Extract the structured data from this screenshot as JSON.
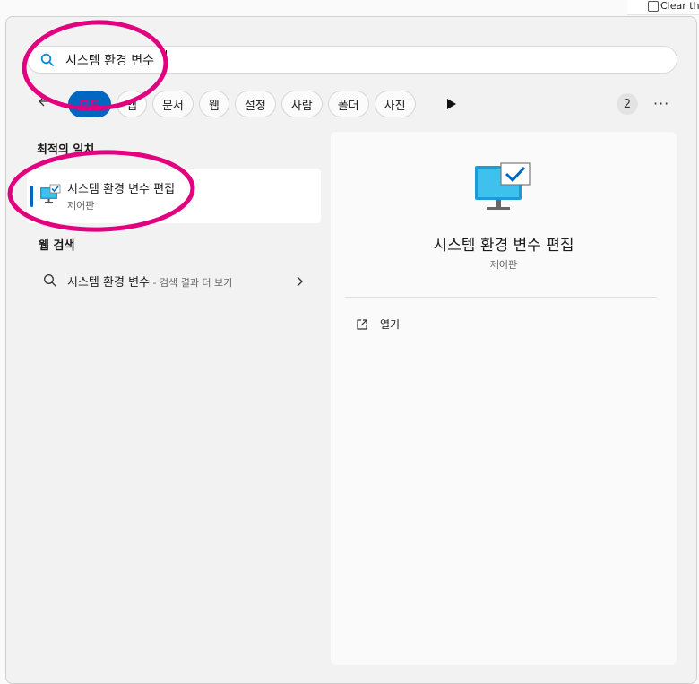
{
  "top": {
    "checkbox_label": "Clear the"
  },
  "search": {
    "query": "시스템 환경 변수"
  },
  "filters": [
    {
      "label": "모두"
    },
    {
      "label": "앱"
    },
    {
      "label": "문서"
    },
    {
      "label": "웹"
    },
    {
      "label": "설정"
    },
    {
      "label": "사람"
    },
    {
      "label": "폴더"
    },
    {
      "label": "사진"
    }
  ],
  "toolbar": {
    "count": "2",
    "more": "···"
  },
  "best_match": {
    "section_label": "최적의 일치",
    "title": "시스템 환경 변수 편집",
    "subtitle": "제어판",
    "icon": "monitor-check-icon"
  },
  "web": {
    "section_label": "웹 검색",
    "query": "시스템 환경 변수",
    "suffix": " - 검색 결과 더 보기"
  },
  "detail": {
    "title": "시스템 환경 변수 편집",
    "subtitle": "제어판",
    "actions": [
      {
        "label": "열기",
        "icon": "open-external-icon"
      }
    ]
  },
  "colors": {
    "accent": "#0067c0",
    "annotation": "#e3007e"
  }
}
